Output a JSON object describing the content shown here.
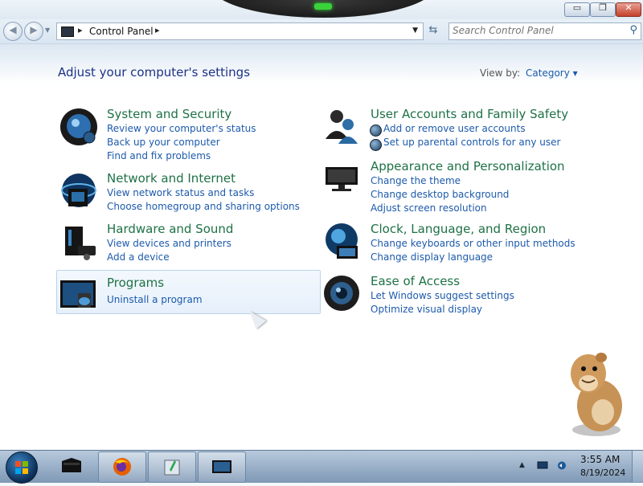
{
  "window": {
    "minimize_label": "▭",
    "maximize_label": "❐",
    "close_label": "✕"
  },
  "address_bar": {
    "breadcrumb": "Control Panel",
    "search_placeholder": "Search Control Panel"
  },
  "main": {
    "heading": "Adjust your computer's settings",
    "view_by_label": "View by:",
    "view_by_value": "Category",
    "categories": [
      {
        "title": "System and Security",
        "icon": "shield-orb-icon",
        "links": [
          "Review your computer's status",
          "Back up your computer",
          "Find and fix problems"
        ]
      },
      {
        "title": "Network and Internet",
        "icon": "network-globe-icon",
        "links": [
          "View network status and tasks",
          "Choose homegroup and sharing options"
        ]
      },
      {
        "title": "Hardware and Sound",
        "icon": "printer-speaker-icon",
        "links": [
          "View devices and printers",
          "Add a device"
        ]
      },
      {
        "title": "Programs",
        "icon": "programs-monitor-icon",
        "links": [
          "Uninstall a program"
        ]
      },
      {
        "title": "User Accounts and Family Safety",
        "icon": "users-icon",
        "links": [
          "Add or remove user accounts",
          "Set up parental controls for any user"
        ]
      },
      {
        "title": "Appearance and Personalization",
        "icon": "monitor-icon",
        "links": [
          "Change the theme",
          "Change desktop background",
          "Adjust screen resolution"
        ]
      },
      {
        "title": "Clock, Language, and Region",
        "icon": "clock-globe-icon",
        "links": [
          "Change keyboards or other input methods",
          "Change display language"
        ]
      },
      {
        "title": "Ease of Access",
        "icon": "ease-of-access-icon",
        "links": [
          "Let Windows suggest settings",
          "Optimize visual display"
        ]
      }
    ]
  },
  "taskbar": {
    "apps": [
      "desktop-app-icon",
      "firefox-icon",
      "notepad-icon",
      "control-panel-icon"
    ],
    "time": "3:55 AM",
    "date": "8/19/2024"
  },
  "colors": {
    "category_title": "#1e7145",
    "link": "#1d5aab",
    "heading": "#1e3287"
  }
}
